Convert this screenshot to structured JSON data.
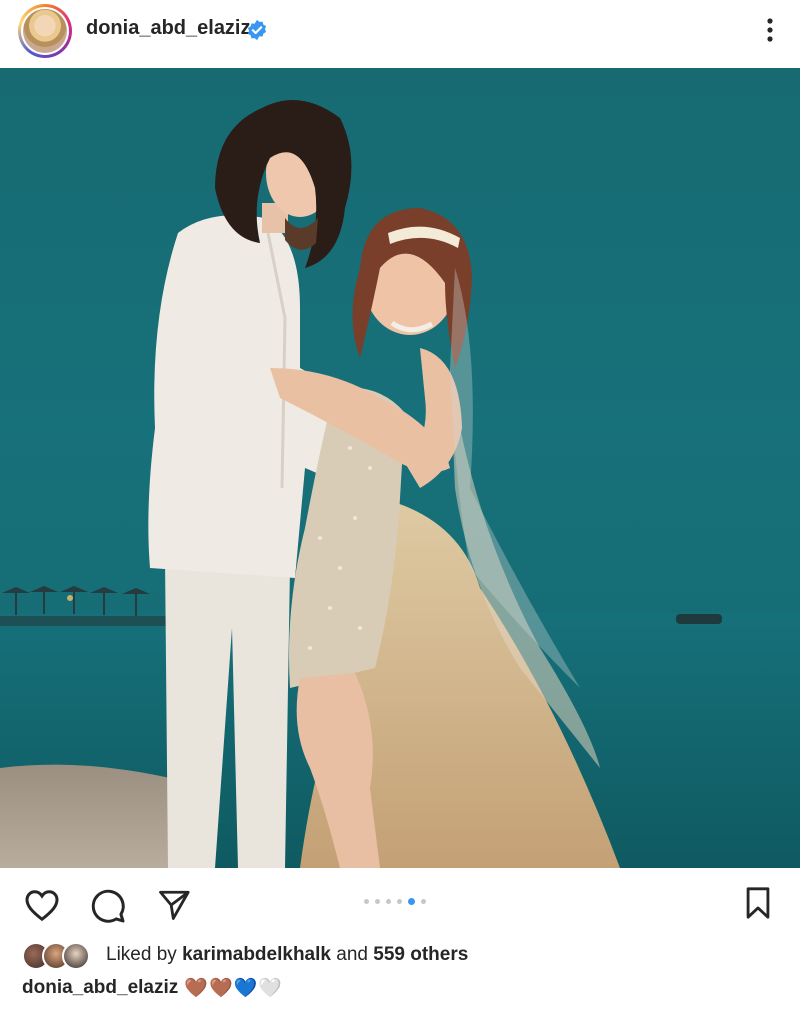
{
  "header": {
    "username": "donia_abd_elaziz",
    "verified_icon": "verified-badge-icon",
    "more_icon": "more-vertical-icon",
    "colors": {
      "verified": "#3897f0"
    }
  },
  "post": {
    "image_alt": "wedding-couple-photo",
    "carousel": {
      "total": 6,
      "current": 5
    }
  },
  "actions": {
    "like_icon": "heart-icon",
    "comment_icon": "comment-icon",
    "share_icon": "send-icon",
    "save_icon": "bookmark-icon"
  },
  "likes": {
    "prefix": "Liked by",
    "user": "karimabdelkhalk",
    "middle": "and",
    "others": "559 others"
  },
  "caption": {
    "username": "donia_abd_elaziz",
    "emojis": "🤎🤎💙🤍"
  }
}
